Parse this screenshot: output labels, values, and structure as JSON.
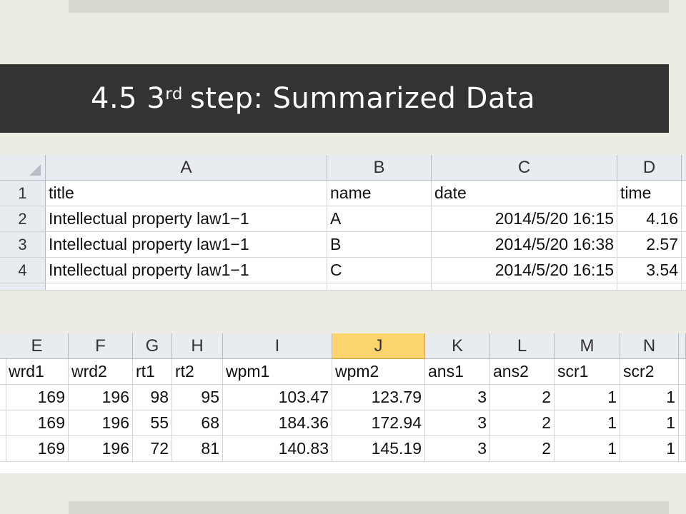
{
  "slide": {
    "title_prefix": "4.5 3",
    "title_sup": "rd",
    "title_rest": "step: Summarized Data"
  },
  "sheet1": {
    "columns": [
      "A",
      "B",
      "C",
      "D"
    ],
    "row_numbers": [
      "1",
      "2",
      "3",
      "4"
    ],
    "rows": [
      [
        "title",
        "name",
        "date",
        "time"
      ],
      [
        "Intellectual property law1−1",
        "A",
        "2014/5/20 16:15",
        "4.16"
      ],
      [
        "Intellectual property law1−1",
        "B",
        "2014/5/20 16:38",
        "2.57"
      ],
      [
        "Intellectual property law1−1",
        "C",
        "2014/5/20 16:15",
        "3.54"
      ]
    ]
  },
  "sheet2": {
    "columns": [
      "E",
      "F",
      "G",
      "H",
      "I",
      "J",
      "K",
      "L",
      "M",
      "N"
    ],
    "selected_column": "J",
    "rows": [
      [
        "wrd1",
        "wrd2",
        "rt1",
        "rt2",
        "wpm1",
        "wpm2",
        "ans1",
        "ans2",
        "scr1",
        "scr2"
      ],
      [
        "169",
        "196",
        "98",
        "95",
        "103.47",
        "123.79",
        "3",
        "2",
        "1",
        "1"
      ],
      [
        "169",
        "196",
        "55",
        "68",
        "184.36",
        "172.94",
        "3",
        "2",
        "1",
        "1"
      ],
      [
        "169",
        "196",
        "72",
        "81",
        "140.83",
        "145.19",
        "3",
        "2",
        "1",
        "1"
      ]
    ]
  },
  "colors": {
    "title_bar": "#333333",
    "background": "#ecece2",
    "header": "#e8ebef",
    "selected_header": "#fbd46e"
  }
}
